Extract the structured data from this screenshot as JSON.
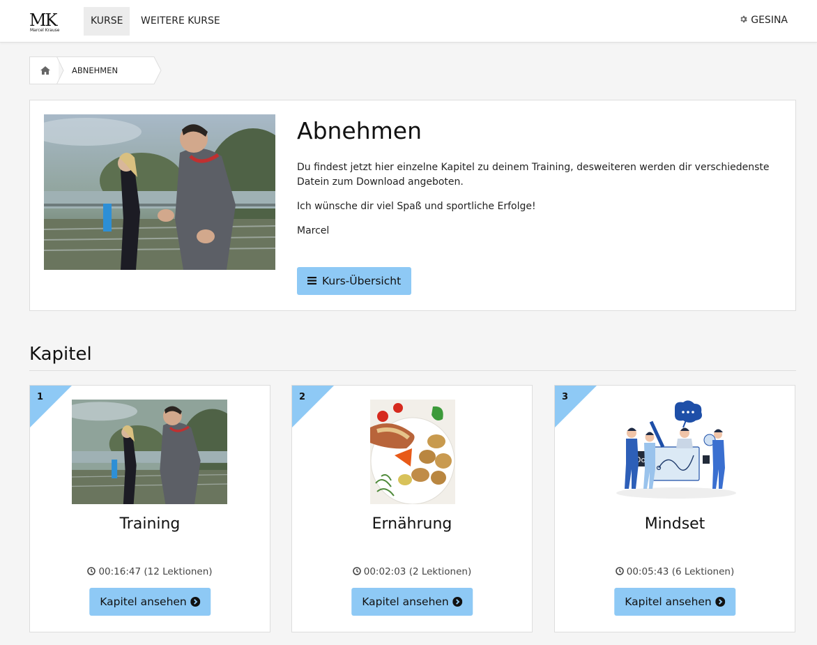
{
  "navbar": {
    "logo_text": "MK",
    "logo_subtext": "Marcel Krause",
    "items": [
      {
        "label": "KURSE",
        "active": true
      },
      {
        "label": "WEITERE KURSE",
        "active": false
      }
    ],
    "user": {
      "label": "GESINA",
      "icon": "gear-icon"
    }
  },
  "breadcrumb": {
    "home_icon": "home-icon",
    "current": "ABNEHMEN"
  },
  "course": {
    "title": "Abnehmen",
    "paragraphs": [
      "Du findest jetzt hier einzelne Kapitel zu deinem Training, desweiteren werden dir verschiedenste Datein zum Download angeboten.",
      "Ich wünsche dir viel Spaß und sportliche Erfolge!",
      "Marcel"
    ],
    "overview_button": "Kurs-Übersicht",
    "overview_icon": "list-icon"
  },
  "chapters": {
    "heading": "Kapitel",
    "items": [
      {
        "number": "1",
        "title": "Training",
        "duration": "00:16:47",
        "lessons": "(12 Lektionen)",
        "button": "Kapitel ansehen"
      },
      {
        "number": "2",
        "title": "Ernährung",
        "duration": "00:02:03",
        "lessons": "(2 Lektionen)",
        "button": "Kapitel ansehen"
      },
      {
        "number": "3",
        "title": "Mindset",
        "duration": "00:05:43",
        "lessons": "(6 Lektionen)",
        "button": "Kapitel ansehen"
      }
    ]
  },
  "colors": {
    "accent": "#8ec9f5",
    "background": "#f5f5f5",
    "panel": "#ffffff",
    "border": "#dddddd"
  }
}
